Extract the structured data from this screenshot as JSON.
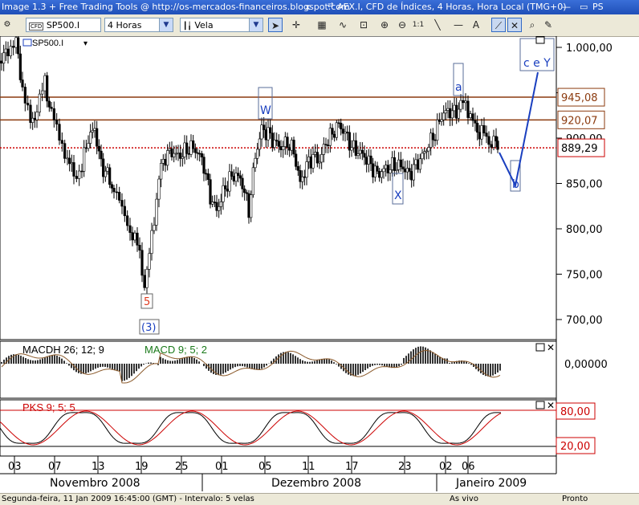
{
  "window": {
    "left_title": "Image 1.3 + Free Trading Tools @ http://os-mercados-financeiros.blogspot.com",
    "right_title": "AEX.I, CFD de Índices, 4 Horas, Hora Local (TMG+0)",
    "corner_text": "PS"
  },
  "toolbar": {
    "symbol": "SP500.I",
    "symbol_tag": "CFD",
    "timeframe": "4 Horas",
    "chart_type": "Vela",
    "ratio_label": "1:1"
  },
  "price_panel": {
    "symbol_label": "SP500.I",
    "y_ticks": [
      "1.000,00",
      "950,00",
      "900,00",
      "850,00",
      "800,00",
      "750,00",
      "700,00"
    ],
    "levels": [
      {
        "value": "945,08",
        "color": "#8b3a0e"
      },
      {
        "value": "920,07",
        "color": "#8b3a0e"
      },
      {
        "value": "889,29",
        "color": "#cc0000"
      }
    ],
    "wave_labels": [
      "W",
      "X",
      "a",
      "b",
      "c e Y",
      "5",
      "(3)"
    ]
  },
  "macd_panel": {
    "title": "MACDH 26; 12; 9",
    "subtitle": "MACD 9; 5; 2",
    "value": "0,00000"
  },
  "pks_panel": {
    "title": "PKS 9; 5; 5",
    "levels": [
      "80,00",
      "20,00"
    ]
  },
  "x_axis": {
    "days": [
      "03",
      "07",
      "13",
      "19",
      "25",
      "01",
      "05",
      "11",
      "17",
      "23",
      "02",
      "06"
    ],
    "months": [
      "Novembro 2008",
      "Dezembro 2008",
      "Janeiro 2009"
    ]
  },
  "statusbar": {
    "left": "Segunda-feira, 11 Jan 2009 16:45:00 (GMT) - Intervalo: 5 velas",
    "mid": "As vivo",
    "right": "Pronto"
  },
  "colors": {
    "titlebar": "#1f4fb8",
    "up_candle": "#ffffff",
    "down_candle": "#000000",
    "resistance": "#8b3a0e",
    "current_price": "#cc0000",
    "wave_line": "#1a3fbf"
  }
}
